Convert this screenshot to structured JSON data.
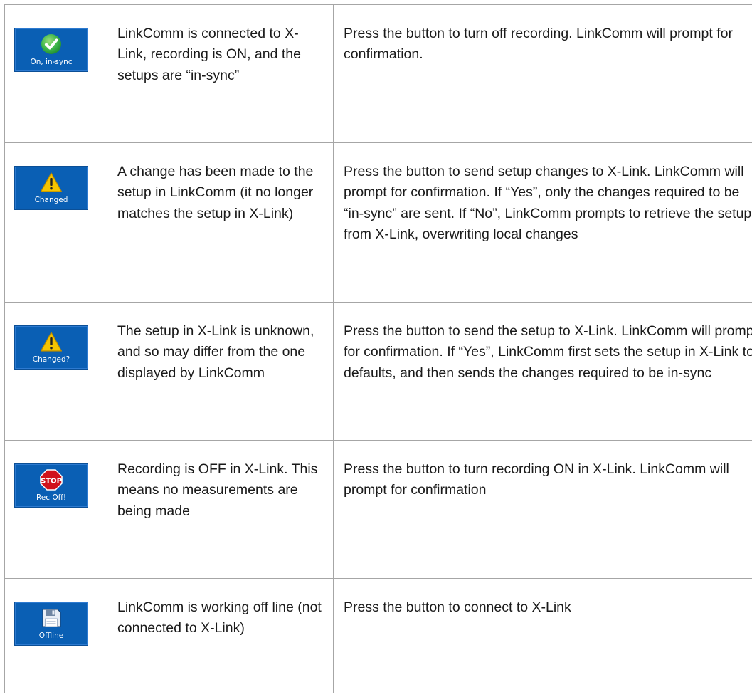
{
  "rows": [
    {
      "button_label": "On, in-sync",
      "icon": "green-check-icon",
      "state": "LinkComm is connected to X-Link, recording is ON, and the setups are “in-sync”",
      "action": "Press the button to turn off recording. LinkComm will prompt for confirmation."
    },
    {
      "button_label": "Changed",
      "icon": "warning-triangle-icon",
      "state": "A change has been made to the setup in LinkComm (it no longer matches the setup in X-Link)",
      "action": "Press the button to send setup changes to X-Link. LinkComm will prompt for confirmation. If “Yes”, only the changes required to be “in-sync” are sent. If “No”, LinkComm prompts to retrieve the setup from X-Link, overwriting local changes"
    },
    {
      "button_label": "Changed?",
      "icon": "warning-triangle-icon",
      "state": "The setup in X-Link is unknown, and so may differ from the one displayed by LinkComm",
      "action": "Press the button to send the setup to X-Link. LinkComm will prompt for confirmation. If “Yes”, LinkComm first sets the setup in X-Link to defaults, and then sends the changes required to be in-sync"
    },
    {
      "button_label": "Rec Off!",
      "icon": "stop-sign-icon",
      "icon_text": "STOP",
      "state": "Recording is OFF in X-Link. This means no measurements are being made",
      "action": "Press the button to turn recording ON in X-Link. LinkComm will prompt for confirmation"
    },
    {
      "button_label": "Offline",
      "icon": "floppy-disk-icon",
      "state": "LinkComm is working off line (not connected to X-Link)",
      "action": "Press the button to connect to X-Link"
    }
  ],
  "colors": {
    "button_bg": "#0a5fb4",
    "check_green": "#3cb54a",
    "warning_yellow": "#f5c400",
    "stop_red": "#d0121b",
    "border": "#a6a6a6"
  }
}
